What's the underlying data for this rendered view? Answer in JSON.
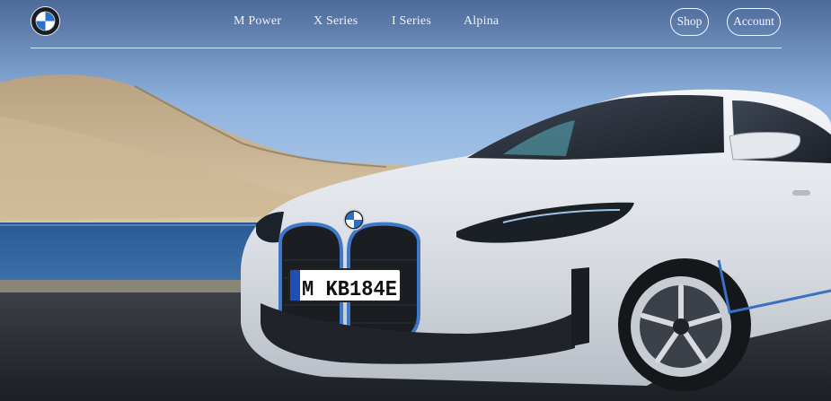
{
  "header": {
    "logo_icon": "bmw-roundel-icon",
    "nav": [
      {
        "label": "M Power"
      },
      {
        "label": "X Series"
      },
      {
        "label": "I Series"
      },
      {
        "label": "Alpina"
      }
    ],
    "shop_label": "Shop",
    "account_label": "Account"
  },
  "hero": {
    "plate_text": "M KB184E",
    "colors": {
      "sky": "#8fb3df",
      "sea": "#2f5f96",
      "car": "#dfe3e9",
      "road": "#262a31"
    }
  }
}
